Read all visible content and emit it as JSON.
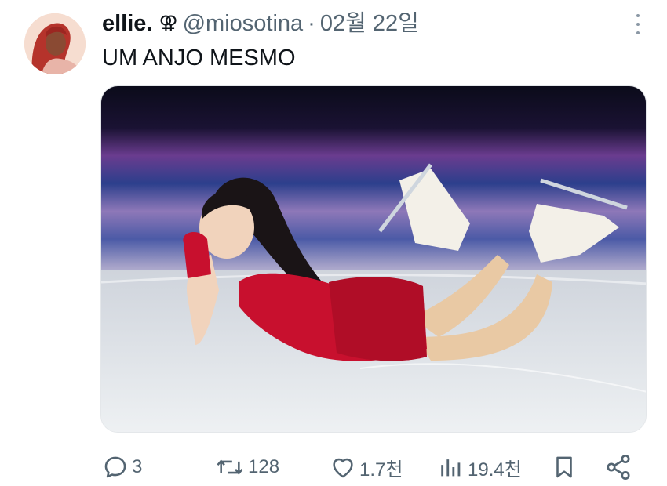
{
  "tweet": {
    "display_name": "ellie.",
    "gender_symbol": "⚢",
    "handle": "@miosotina",
    "separator": "·",
    "date": "02월 22일",
    "text": "UM ANJO MESMO"
  },
  "actions": {
    "replies": "3",
    "retweets": "128",
    "likes": "1.7천",
    "views": "19.4천"
  },
  "icons": {
    "reply": "reply-icon",
    "retweet": "retweet-icon",
    "like": "heart-icon",
    "views": "views-icon",
    "bookmark": "bookmark-icon",
    "share": "share-icon",
    "more": "more-vertical-icon"
  },
  "colors": {
    "text": "#0f1419",
    "secondary": "#536471",
    "dress": "#c8102e",
    "ice": "#e8ecef"
  }
}
